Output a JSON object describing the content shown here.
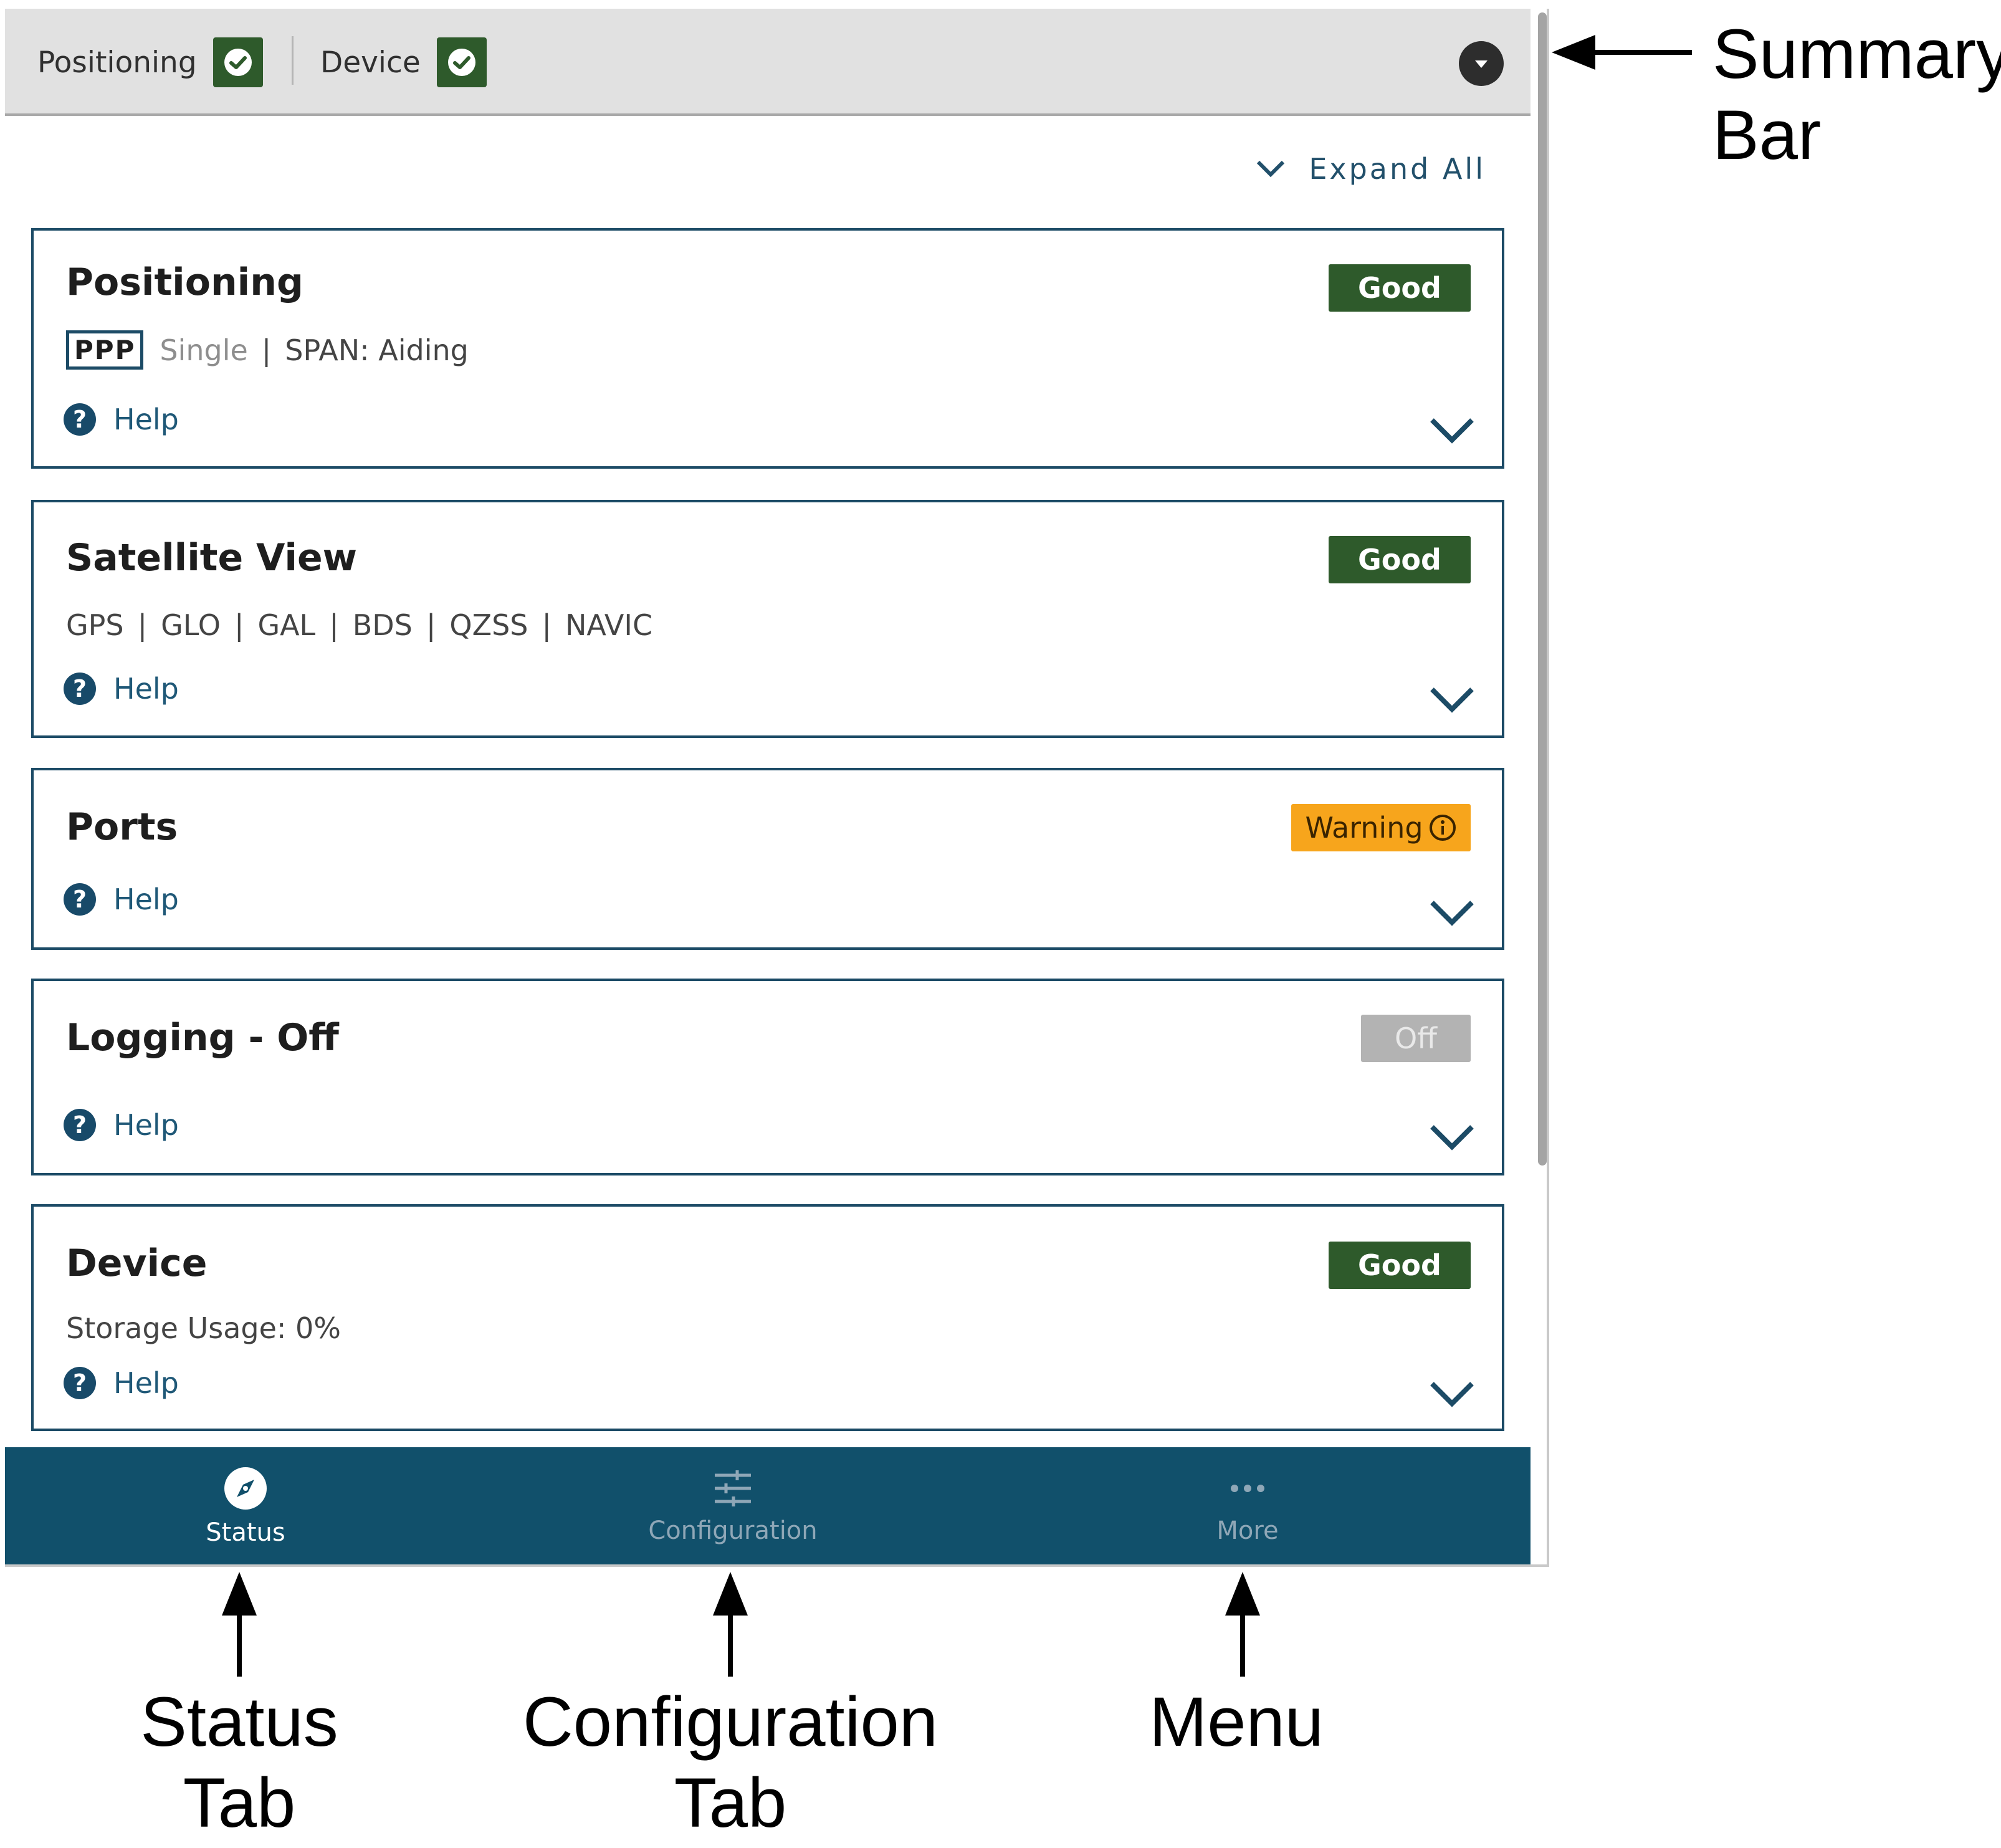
{
  "summary_bar": {
    "items": [
      {
        "label": "Positioning",
        "status_icon": "check-icon"
      },
      {
        "label": "Device",
        "status_icon": "check-icon"
      }
    ],
    "toggle_icon": "collapse-icon"
  },
  "expand_all_label": "Expand All",
  "cards": [
    {
      "title": "Positioning",
      "status": "Good",
      "subline": {
        "mode_box": "PPP",
        "mode_muted": "Single",
        "separator": "|",
        "detail": "SPAN: Aiding"
      },
      "help_label": "Help"
    },
    {
      "title": "Satellite View",
      "status": "Good",
      "constellations": [
        "GPS",
        "GLO",
        "GAL",
        "BDS",
        "QZSS",
        "NAVIC"
      ],
      "separator": "|",
      "help_label": "Help"
    },
    {
      "title": "Ports",
      "status": "Warning",
      "status_icon": "info-icon",
      "help_label": "Help"
    },
    {
      "title": "Logging - Off",
      "status": "Off",
      "help_label": "Help"
    },
    {
      "title": "Device",
      "status": "Good",
      "detail": "Storage Usage: 0%",
      "help_label": "Help"
    }
  ],
  "bottom_nav": {
    "tabs": [
      {
        "label": "Status",
        "icon": "compass-icon",
        "active": true
      },
      {
        "label": "Configuration",
        "icon": "sliders-icon",
        "active": false
      },
      {
        "label": "More",
        "icon": "dots-icon",
        "active": false
      }
    ]
  },
  "annotations": {
    "summary_bar": [
      "Summary",
      "Bar"
    ],
    "status_tab": [
      "Status",
      "Tab"
    ],
    "configuration_tab": [
      "Configuration",
      "Tab"
    ],
    "menu": "Menu"
  },
  "colors": {
    "good": "#2e5a2b",
    "warning": "#f7a51c",
    "off": "#b3b3b3",
    "nav_background": "#11506b",
    "card_border": "#1c4b66"
  }
}
